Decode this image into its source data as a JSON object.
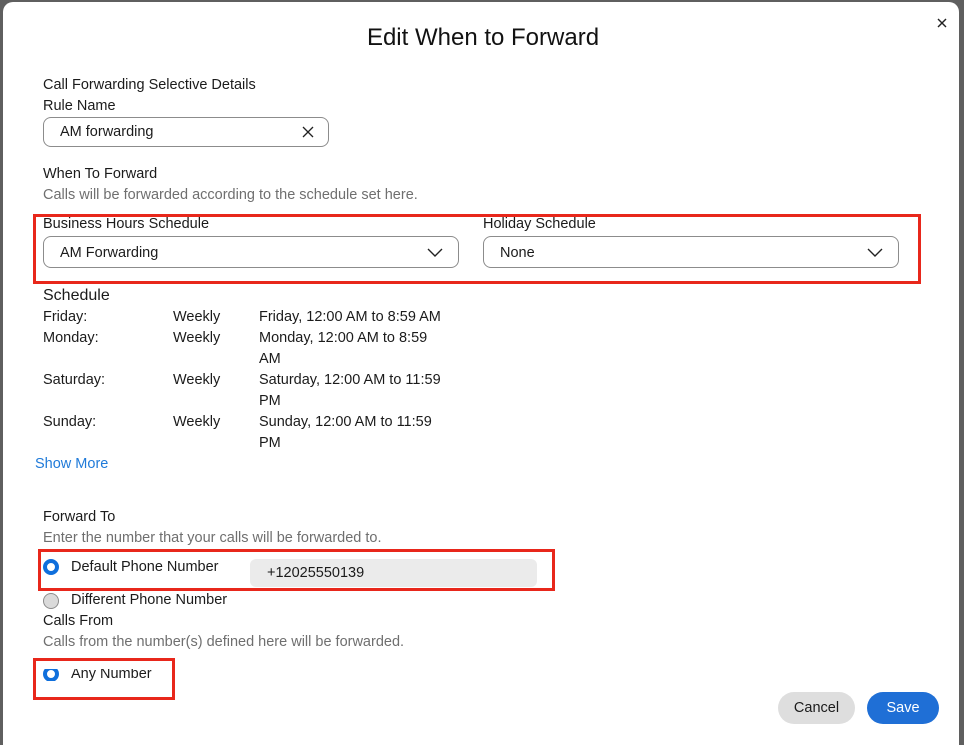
{
  "dialog": {
    "title": "Edit When to Forward",
    "close_icon": "close-icon"
  },
  "details": {
    "section_label": "Call Forwarding Selective Details",
    "rule_name_label": "Rule Name",
    "rule_name_value": "AM forwarding",
    "clear_icon": "clear-x-icon"
  },
  "when_to_forward": {
    "label": "When To Forward",
    "description": "Calls will be forwarded according to the schedule set here.",
    "business_hours": {
      "label": "Business Hours Schedule",
      "selected": "AM Forwarding",
      "icon": "chevron-down-icon"
    },
    "holiday": {
      "label": "Holiday Schedule",
      "selected": "None",
      "icon": "chevron-down-icon"
    }
  },
  "schedule": {
    "label": "Schedule",
    "rows": [
      {
        "day": "Friday:",
        "recurrence": "Weekly",
        "time": "Friday, 12:00 AM to 8:59 AM"
      },
      {
        "day": "Monday:",
        "recurrence": "Weekly",
        "time": "Monday, 12:00 AM to 8:59 AM"
      },
      {
        "day": "Saturday:",
        "recurrence": "Weekly",
        "time": "Saturday, 12:00 AM to 11:59 PM"
      },
      {
        "day": "Sunday:",
        "recurrence": "Weekly",
        "time": "Sunday, 12:00 AM to 11:59 PM"
      }
    ],
    "show_more": "Show More"
  },
  "forward_to": {
    "label": "Forward To",
    "description": "Enter the number that your calls will be forwarded to.",
    "options": [
      {
        "label": "Default Phone Number",
        "selected": true
      },
      {
        "label": "Different Phone Number",
        "selected": false
      }
    ],
    "default_number": "+12025550139"
  },
  "calls_from": {
    "label": "Calls From",
    "description": "Calls from the number(s) defined here will be forwarded.",
    "options": [
      {
        "label": "Any Number",
        "selected": true
      }
    ]
  },
  "footer": {
    "cancel_label": "Cancel",
    "save_label": "Save"
  },
  "colors": {
    "accent": "#1f6fd6",
    "highlight": "#e8271b",
    "link": "#1f7ad9"
  }
}
